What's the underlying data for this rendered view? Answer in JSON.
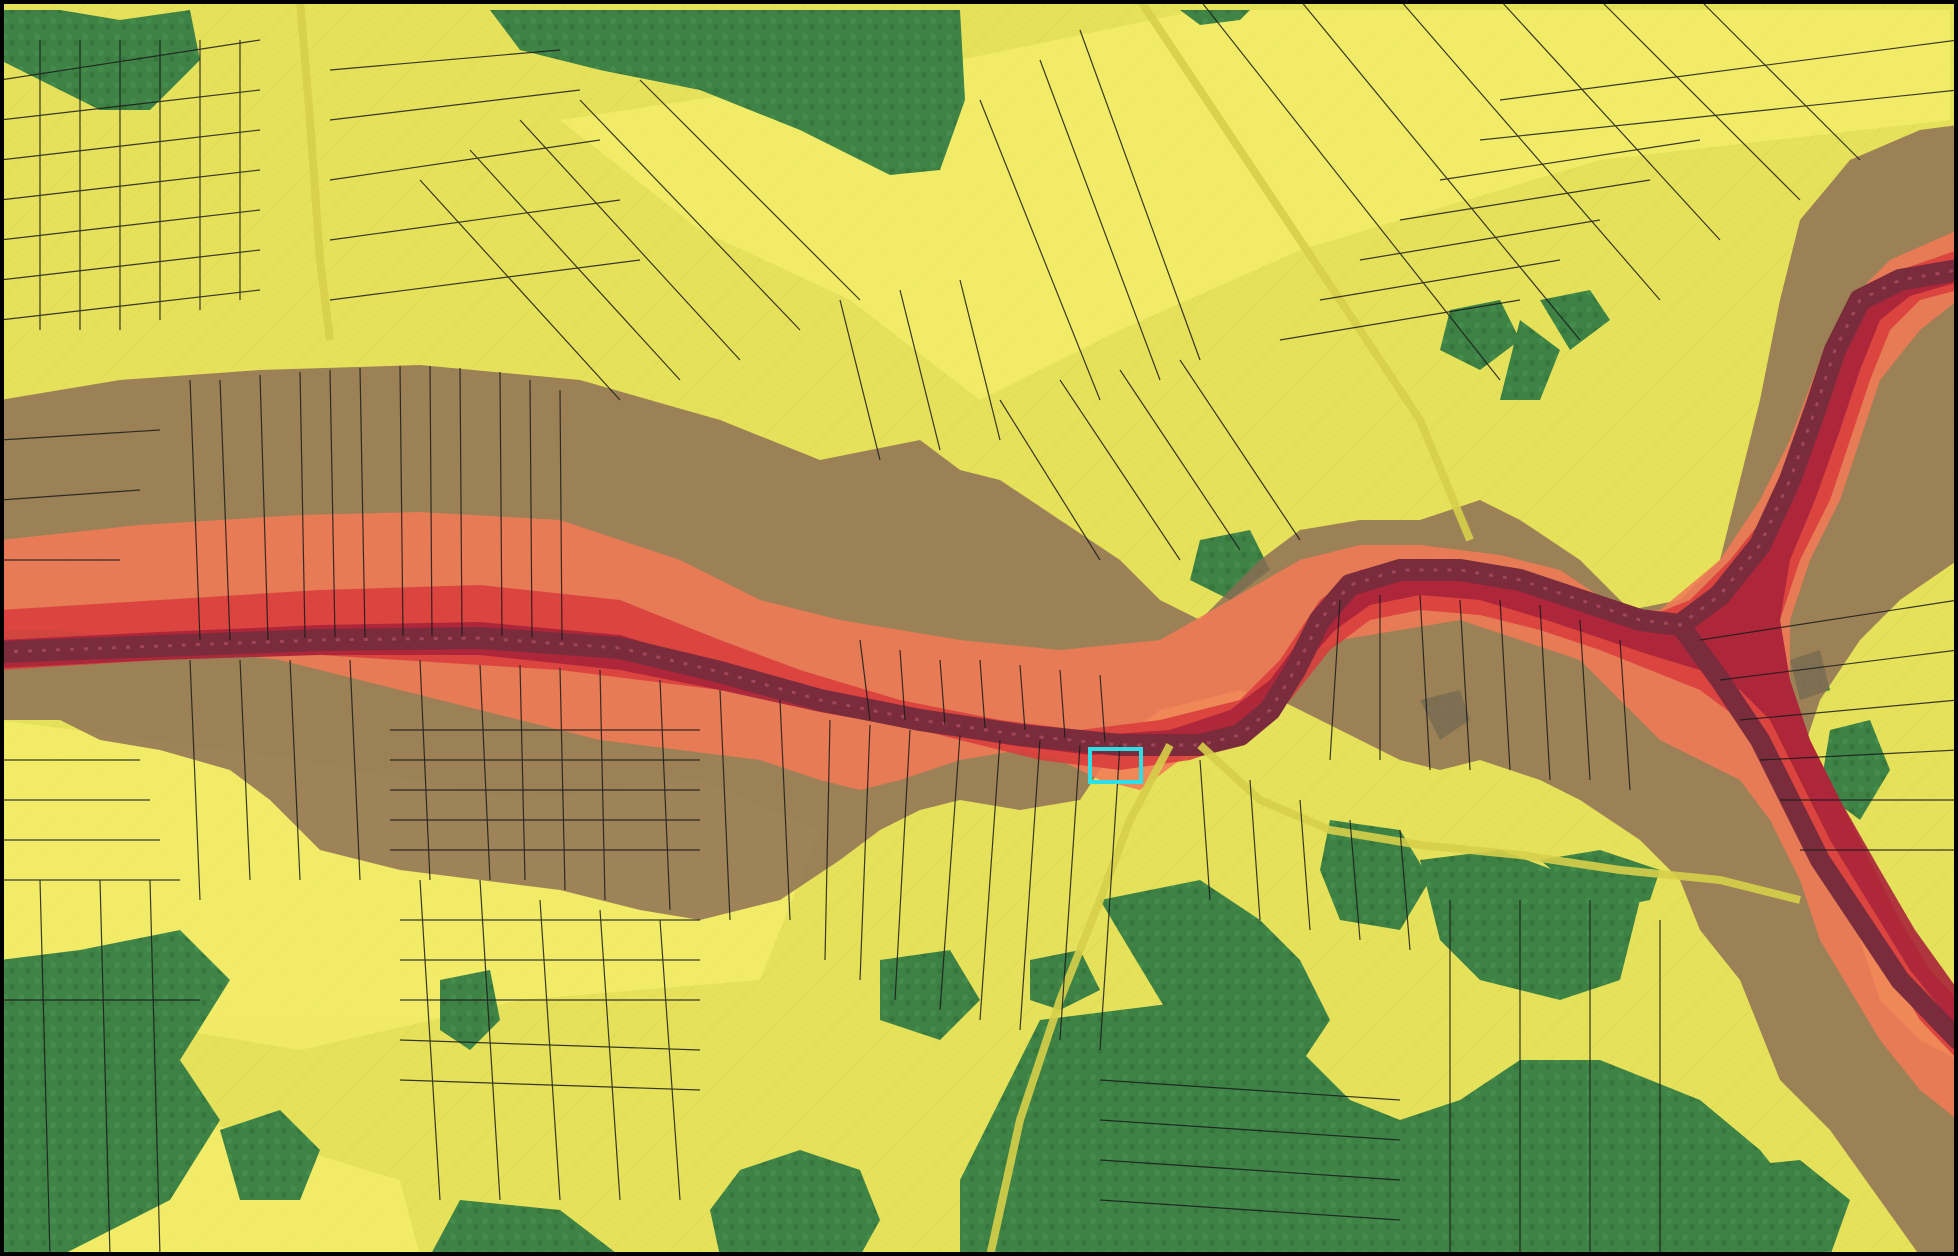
{
  "map": {
    "type": "noise-zone overlay on cadastral parcel map",
    "colors": {
      "background_fields": "#e8e35a",
      "forest": "#2f7a43",
      "zone_brown": "#8c6b55",
      "zone_orange": "#f07a55",
      "zone_red": "#d93c3c",
      "zone_darkred": "#a8243a",
      "road": "#7a2c3c",
      "parcel_lines": "#1a1a1a",
      "selection_outline": "#2de0e8",
      "frame_border": "#000000"
    },
    "layers": [
      "aerial-imagery",
      "vegetation",
      "noise-zones",
      "road",
      "parcel-boundaries",
      "selected-parcel"
    ]
  }
}
